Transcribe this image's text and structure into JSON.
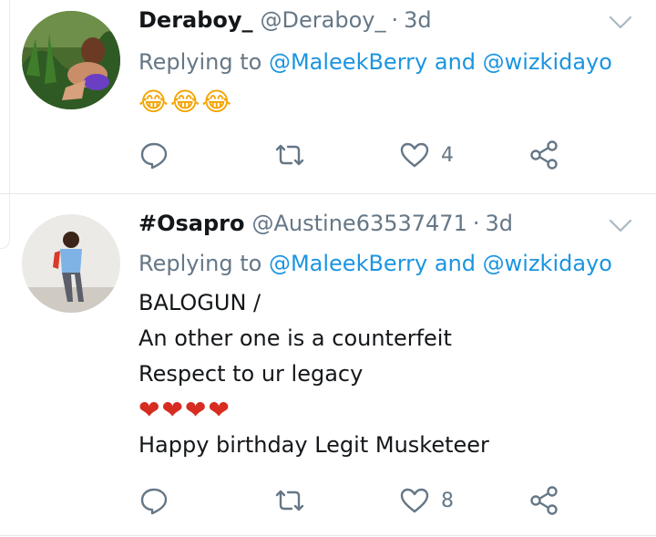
{
  "tweets": [
    {
      "name": "Deraboy_",
      "handle": "@Deraboy_",
      "separator": "·",
      "time": "3d",
      "replying_prefix": "Replying to",
      "mention1": "@MaleekBerry",
      "joiner": "and",
      "mention2": "@wizkidayo",
      "lines": [
        "😂😂😂"
      ],
      "like_count": "4"
    },
    {
      "name": "#Osapro",
      "handle": "@Austine63537471",
      "separator": "·",
      "time": "3d",
      "replying_prefix": "Replying to",
      "mention1": "@MaleekBerry",
      "joiner": "and",
      "mention2": "@wizkidayo",
      "lines": [
        "BALOGUN /",
        "An other one is a counterfeit",
        "Respect to ur legacy",
        "❤❤❤❤",
        "Happy birthday Legit Musketeer"
      ],
      "like_count": "8"
    }
  ],
  "colors": {
    "link": "#1b95e0",
    "secondary": "#657786",
    "text": "#14171a",
    "divider": "#e1e8ed",
    "heart_emoji": "#d62d20"
  },
  "icons": [
    "reply-icon",
    "retweet-icon",
    "like-icon",
    "share-icon",
    "chevron-down-icon"
  ]
}
